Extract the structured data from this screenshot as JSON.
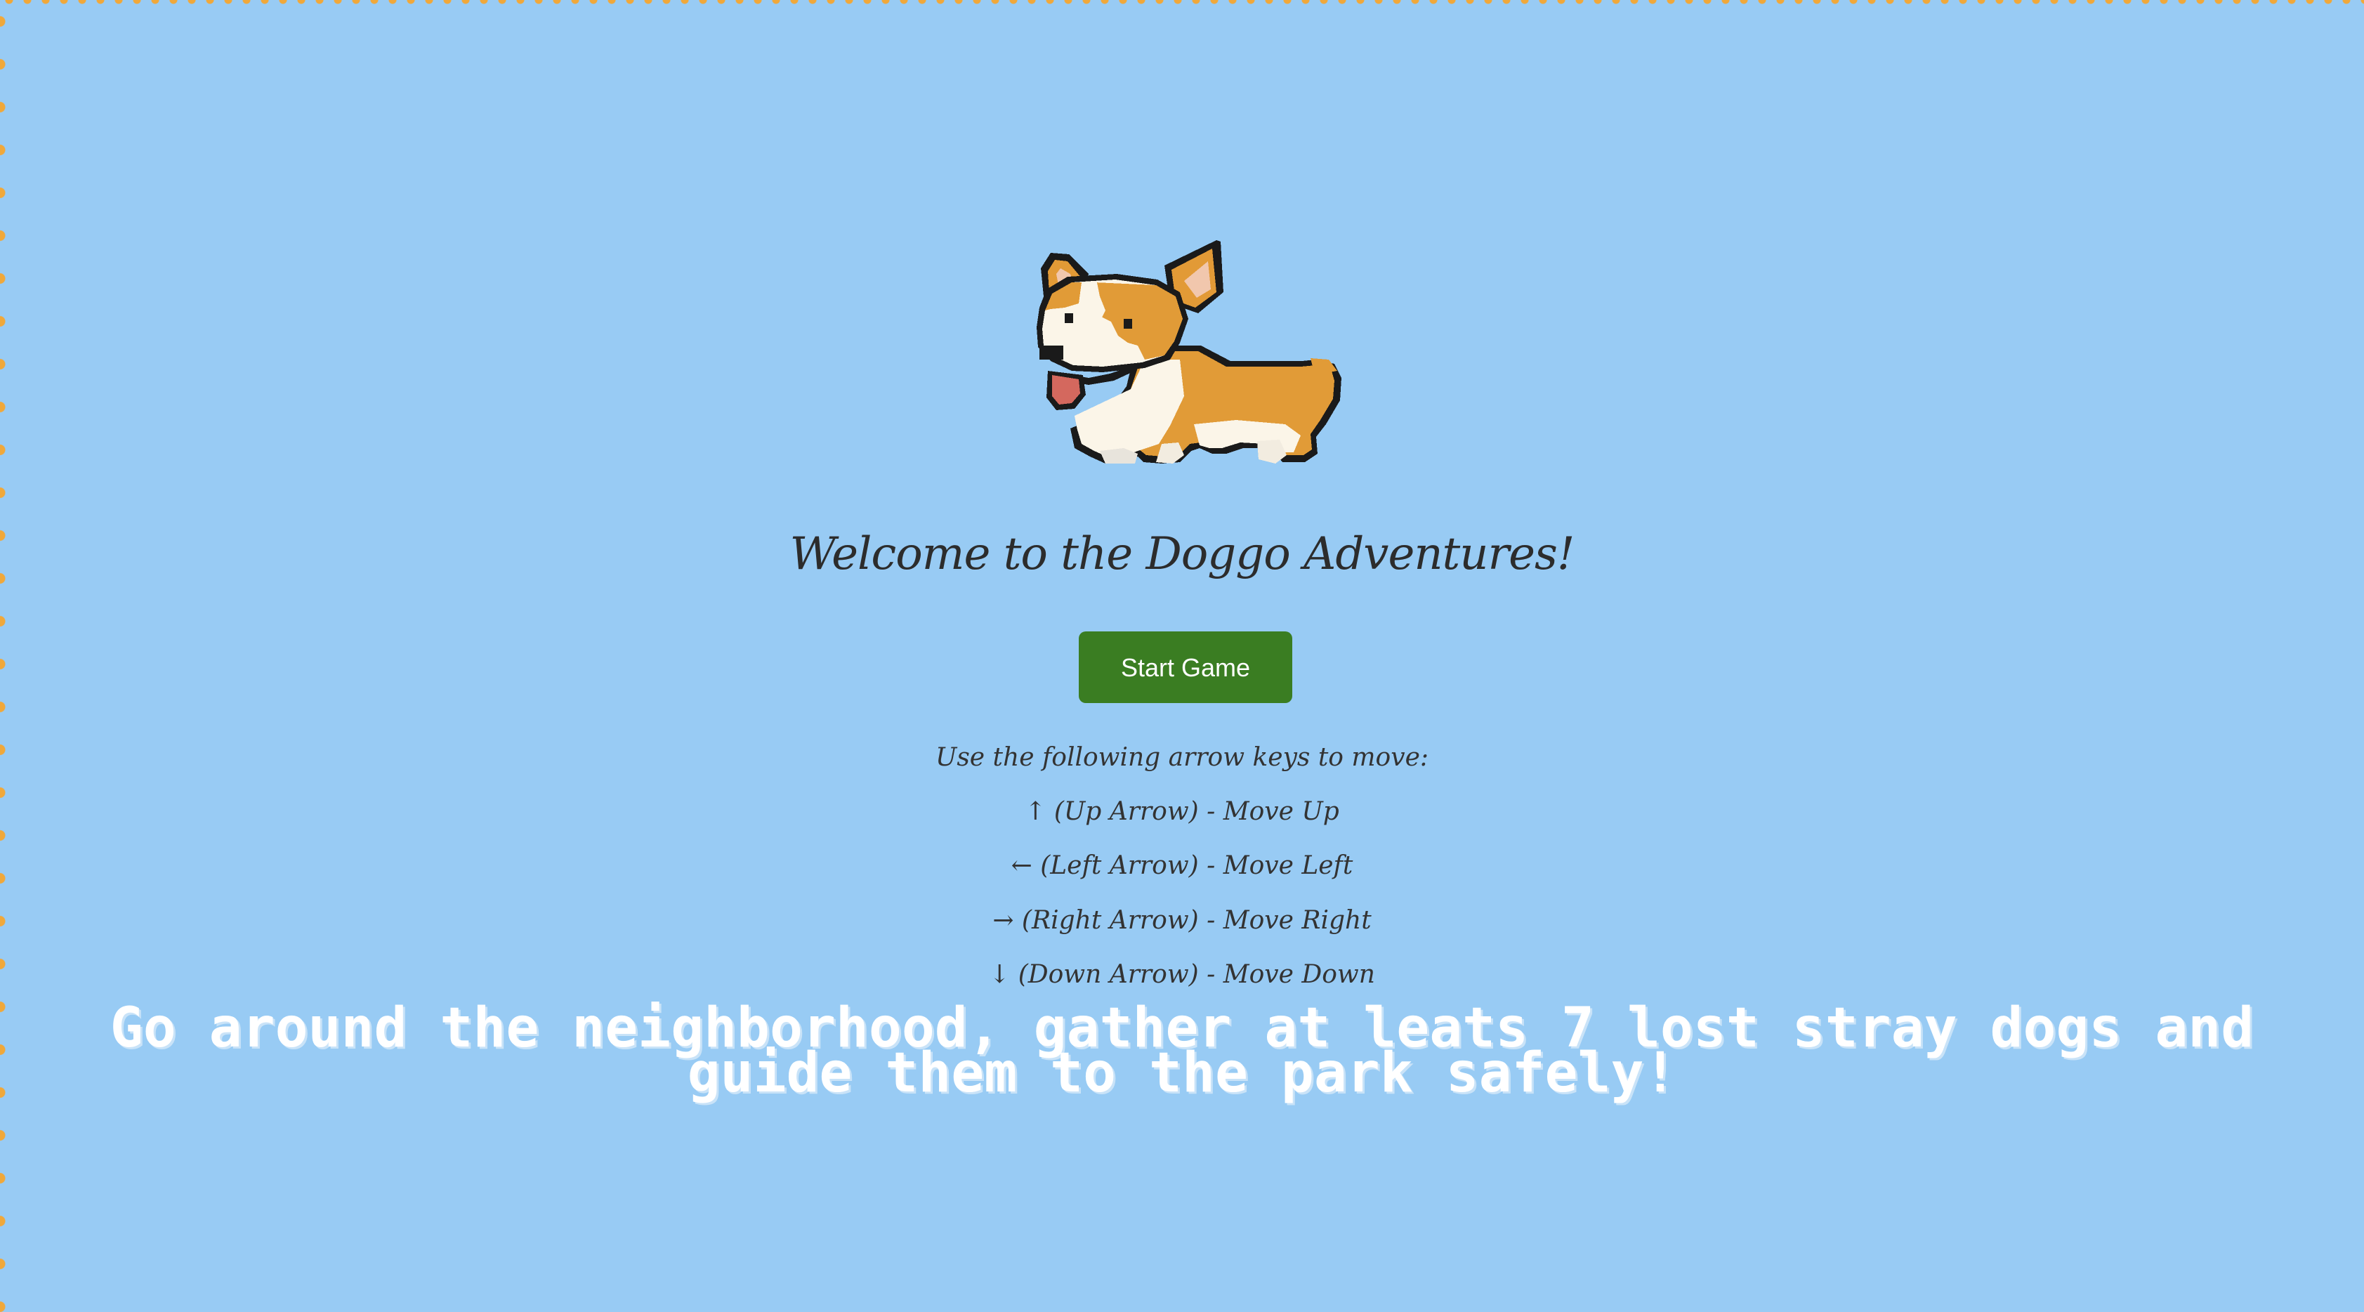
{
  "colors": {
    "background": "#98cbf4",
    "border_dots": "#f0a83a",
    "button": "#3a7d22",
    "button_text": "#ffffff",
    "title_text": "#2c2c2c",
    "mission_text": "#ffffff"
  },
  "hero": {
    "image": "corgi-pixel-art"
  },
  "title": "Welcome to the Doggo Adventures!",
  "start_button": "Start Game",
  "instructions": {
    "heading": "Use the following arrow keys to move:",
    "keys": [
      "↑ (Up Arrow) - Move Up",
      "← (Left Arrow) - Move Left",
      "→ (Right Arrow) - Move Right",
      "↓ (Down Arrow) - Move Down"
    ]
  },
  "mission": "Go around the neighborhood, gather at leats 7 lost stray dogs and guide them to the park safely!"
}
